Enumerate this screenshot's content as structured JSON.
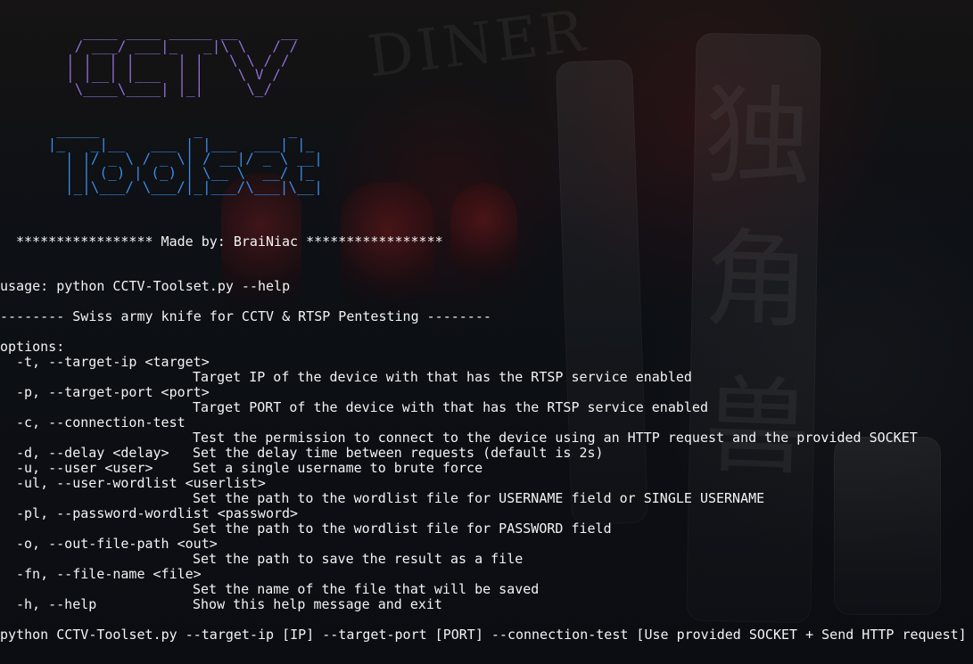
{
  "ascii": {
    "cctv": "  ____ ____ _____ __     __\n / ___/ ___|_   _|\\ \\   / /\n| |  | |     | |   \\ \\ / / \n| |__| |___  | |    \\ V /  \n \\____\\____| |_|     \\_/   ",
    "toolset": "  _____           _          _   \n |_   _|__   ___ | |___  ___| |_ \n   | |/ _ \\ / _ \\| / __|/ _ \\ __|\n   | | (_) | (_) | \\__ \\  __/ |_ \n   |_|\\___/ \\___/|_|___/\\___|\\__|"
  },
  "terminal": {
    "banner": "***************** Made by: BraiNiac *****************",
    "usage": "usage: python CCTV-Toolset.py --help",
    "description": "-------- Swiss army knife for CCTV & RTSP Pentesting --------",
    "options_title": "options:",
    "options": [
      {
        "key": "-t, --target-ip <target>",
        "desc": "Target IP of the device with that has the RTSP service enabled"
      },
      {
        "key": "-p, --target-port <port>",
        "desc": "Target PORT of the device with that has the RTSP service enabled"
      },
      {
        "key": "-c, --connection-test",
        "desc": "Test the permission to connect to the device using an HTTP request and the provided SOCKET"
      },
      {
        "key": "-d, --delay <delay>",
        "desc": "Set the delay time between requests (default is 2s)"
      },
      {
        "key": "-u, --user <user>",
        "desc": "Set a single username to brute force"
      },
      {
        "key": "-ul, --user-wordlist <userlist>",
        "desc": "Set the path to the wordlist file for USERNAME field or SINGLE USERNAME"
      },
      {
        "key": "-pl, --password-wordlist <password>",
        "desc": "Set the path to the wordlist file for PASSWORD field"
      },
      {
        "key": "-o, --out-file-path <out>",
        "desc": "Set the path to save the result as a file"
      },
      {
        "key": "-fn, --file-name <file>",
        "desc": "Set the name of the file that will be saved"
      },
      {
        "key": "-h, --help",
        "desc": "Show this help message and exit"
      }
    ],
    "command_line": "python CCTV-Toolset.py --target-ip [IP] --target-port [PORT] --connection-test [Use provided SOCKET + Send HTTP request]"
  },
  "background": {
    "sign_text_1": "DINER",
    "sign_text_2": "独",
    "sign_text_3": "角",
    "sign_text_4": "兽"
  },
  "colors": {
    "cctv_ascii": "#8f6fd7",
    "toolset_ascii": "#3a8ce7",
    "terminal_text": "#f3f3f3",
    "background": "#0b0d12"
  }
}
